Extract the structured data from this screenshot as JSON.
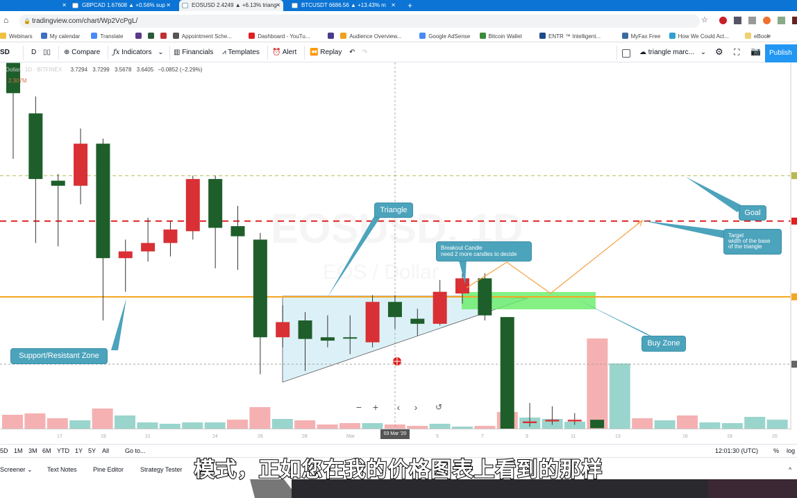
{
  "browser": {
    "tabs": [
      {
        "label": "GBPCAD 1.67608 ▲ +0.56% sup",
        "active": false
      },
      {
        "label": "EOSUSD 2.4249 ▲ +6.13% triang",
        "active": true
      },
      {
        "label": "BTCUSDT 6686.56 ▲ +13.43% m",
        "active": false
      }
    ],
    "new_tab": "+",
    "close": "✕",
    "url": "tradingview.com/chart/Wp2VcPgL/",
    "bookmarks": [
      {
        "label": "Webinars",
        "color": "#f0c040"
      },
      {
        "label": "My calendar",
        "color": "#3f6fc0"
      },
      {
        "label": "Translate",
        "color": "#4a8af4"
      },
      {
        "label": "",
        "color": "#5a3a8a"
      },
      {
        "label": "",
        "color": "#2a5a3a"
      },
      {
        "label": "",
        "color": "#c03030"
      },
      {
        "label": "Appointment Sche...",
        "color": "#555"
      },
      {
        "label": "Dashboard - YouTu...",
        "color": "#e02020"
      },
      {
        "label": "",
        "color": "#4a3a8a"
      },
      {
        "label": "Audience Overview...",
        "color": "#f0a020"
      },
      {
        "label": "Google AdSense",
        "color": "#4a8af4"
      },
      {
        "label": "Bitcoin Wallet",
        "color": "#3a8a3a"
      },
      {
        "label": "ENTR ™ Intelligent...",
        "color": "#1a4a8a"
      },
      {
        "label": "MyFax Free",
        "color": "#3a6aa0"
      },
      {
        "label": "How We Could Act...",
        "color": "#30a0d0"
      },
      {
        "label": "eBook",
        "color": "#f0d070"
      }
    ],
    "more": "»"
  },
  "toolbar": {
    "symbol": "SD",
    "interval": "D",
    "compare": "Compare",
    "indicators": "Indicators",
    "financials": "Financials",
    "templates": "Templates",
    "alert": "Alert",
    "replay": "Replay",
    "layout_name": "triangle marc...",
    "publish": "Publish"
  },
  "legend": {
    "title": "Dollar · 1D · BITFINEX",
    "open": "3.7294",
    "high": "3.7299",
    "low": "3.5678",
    "close": "3.6405",
    "change": "−0.0852 (−2.29%)",
    "volume": "2.307M"
  },
  "watermark": {
    "symbol": "EOSUSD, 1D",
    "pair": "EOS / Dollar"
  },
  "annotations": {
    "triangle": "Triangle",
    "breakout_title": "Breakout Candle",
    "breakout_note": "need 2 more candles to decide",
    "goal": "Goal",
    "target_1": "Target",
    "target_2": "width of the base",
    "target_3": "of the triangle",
    "buy_zone": "Buy Zone",
    "support": "Support/Resistant Zone"
  },
  "colors": {
    "up": "#1e5e2a",
    "down": "#d83034",
    "vol_up": "#8fd0c8",
    "vol_down": "#f4a8aa",
    "accent": "#2196f3",
    "orange": "#f5a623",
    "red_line": "#e02020",
    "olive_line": "#b8b850",
    "buy_zone": "#66ee66",
    "callout": "#4ca3bc"
  },
  "chart_data": {
    "type": "candlestick",
    "symbol": "EOSUSD",
    "interval": "1D",
    "candles": [
      {
        "o": 3.63,
        "h": 3.81,
        "l": 3.24,
        "c": 3.81
      },
      {
        "o": 3.12,
        "h": 3.61,
        "l": 2.74,
        "c": 3.51
      },
      {
        "o": 3.08,
        "h": 3.15,
        "l": 2.72,
        "c": 3.11
      },
      {
        "o": 3.33,
        "h": 3.42,
        "l": 2.97,
        "c": 3.08
      },
      {
        "o": 2.65,
        "h": 3.36,
        "l": 2.28,
        "c": 3.33
      },
      {
        "o": 2.69,
        "h": 2.76,
        "l": 2.45,
        "c": 2.65
      },
      {
        "o": 2.74,
        "h": 2.89,
        "l": 2.63,
        "c": 2.69
      },
      {
        "o": 2.82,
        "h": 2.87,
        "l": 2.66,
        "c": 2.74
      },
      {
        "o": 3.12,
        "h": 3.14,
        "l": 2.76,
        "c": 2.81
      },
      {
        "o": 2.83,
        "h": 3.14,
        "l": 2.59,
        "c": 3.12
      },
      {
        "o": 2.78,
        "h": 2.96,
        "l": 2.58,
        "c": 2.84
      },
      {
        "o": 2.18,
        "h": 2.8,
        "l": 1.96,
        "c": 2.76
      },
      {
        "o": 2.27,
        "h": 2.37,
        "l": 2.12,
        "c": 2.18
      },
      {
        "o": 2.17,
        "h": 2.33,
        "l": 1.98,
        "c": 2.28
      },
      {
        "o": 2.16,
        "h": 2.31,
        "l": 2.12,
        "c": 2.18
      },
      {
        "o": 2.18,
        "h": 2.31,
        "l": 2.08,
        "c": 2.18
      },
      {
        "o": 2.39,
        "h": 2.43,
        "l": 2.12,
        "c": 2.15
      },
      {
        "o": 2.3,
        "h": 2.43,
        "l": 2.23,
        "c": 2.39
      },
      {
        "o": 2.26,
        "h": 2.35,
        "l": 2.19,
        "c": 2.29
      },
      {
        "o": 2.45,
        "h": 2.52,
        "l": 2.25,
        "c": 2.26
      },
      {
        "o": 2.53,
        "h": 2.56,
        "l": 2.38,
        "c": 2.44
      },
      {
        "o": 2.31,
        "h": 2.56,
        "l": 2.28,
        "c": 2.53
      },
      {
        "o": 1.6,
        "h": 2.3,
        "l": 1.6,
        "c": 2.3
      },
      {
        "o": 1.68,
        "h": 1.79,
        "l": 1.65,
        "c": 1.67
      },
      {
        "o": 1.69,
        "h": 1.77,
        "l": 1.66,
        "c": 1.68
      },
      {
        "o": 1.69,
        "h": 1.73,
        "l": 1.66,
        "c": 1.68
      },
      {
        "o": 1.64,
        "h": 1.69,
        "l": 1.64,
        "c": 1.69
      }
    ],
    "volume": [
      {
        "v": 2.0,
        "up": false
      },
      {
        "v": 2.2,
        "up": false
      },
      {
        "v": 1.5,
        "up": false
      },
      {
        "v": 1.2,
        "up": true
      },
      {
        "v": 2.9,
        "up": false
      },
      {
        "v": 1.9,
        "up": true
      },
      {
        "v": 0.9,
        "up": true
      },
      {
        "v": 0.7,
        "up": true
      },
      {
        "v": 0.9,
        "up": true
      },
      {
        "v": 0.9,
        "up": true
      },
      {
        "v": 1.3,
        "up": false
      },
      {
        "v": 3.1,
        "up": false
      },
      {
        "v": 1.4,
        "up": true
      },
      {
        "v": 1.2,
        "up": false
      },
      {
        "v": 0.6,
        "up": false
      },
      {
        "v": 0.8,
        "up": false
      },
      {
        "v": 0.8,
        "up": true
      },
      {
        "v": 0.6,
        "up": false
      },
      {
        "v": 0.4,
        "up": false
      },
      {
        "v": 0.7,
        "up": true
      },
      {
        "v": 0.3,
        "up": true
      },
      {
        "v": 0.4,
        "up": false
      },
      {
        "v": 2.4,
        "up": false
      },
      {
        "v": 1.6,
        "up": true
      },
      {
        "v": 1.4,
        "up": true
      },
      {
        "v": 1.0,
        "up": true
      },
      {
        "v": 13.0,
        "up": false
      },
      {
        "v": 9.4,
        "up": true
      },
      {
        "v": 1.5,
        "up": false
      },
      {
        "v": 1.2,
        "up": true
      },
      {
        "v": 1.9,
        "up": false
      },
      {
        "v": 0.9,
        "up": true
      },
      {
        "v": 0.8,
        "up": true
      },
      {
        "v": 1.7,
        "up": true
      },
      {
        "v": 1.3,
        "up": true
      }
    ],
    "levels": {
      "olive": 3.14,
      "target": 2.87,
      "resistance": 2.42,
      "gray": 2.02
    },
    "x_ticks": [
      "17",
      "19",
      "21",
      "24",
      "26",
      "28",
      "Mar",
      "5",
      "7",
      "9",
      "11",
      "13",
      "16",
      "18",
      "20"
    ],
    "crosshair_date": "03 Mar '20"
  },
  "chart_nav": {
    "zoom_out": "−",
    "zoom_in": "+",
    "back": "‹",
    "forward": "›",
    "reset": "↺"
  },
  "range": {
    "buttons": [
      "5D",
      "1M",
      "3M",
      "6M",
      "YTD",
      "1Y",
      "5Y",
      "All"
    ],
    "goto": "Go to...",
    "time": "12:01:30 (UTC)",
    "percent": "%",
    "log": "log"
  },
  "panels": {
    "tabs": [
      "Screener",
      "Text Notes",
      "Pine Editor",
      "Strategy Tester"
    ],
    "collapse": "^"
  },
  "subtitle": "模式，正如您在我的价格图表上看到的那样"
}
